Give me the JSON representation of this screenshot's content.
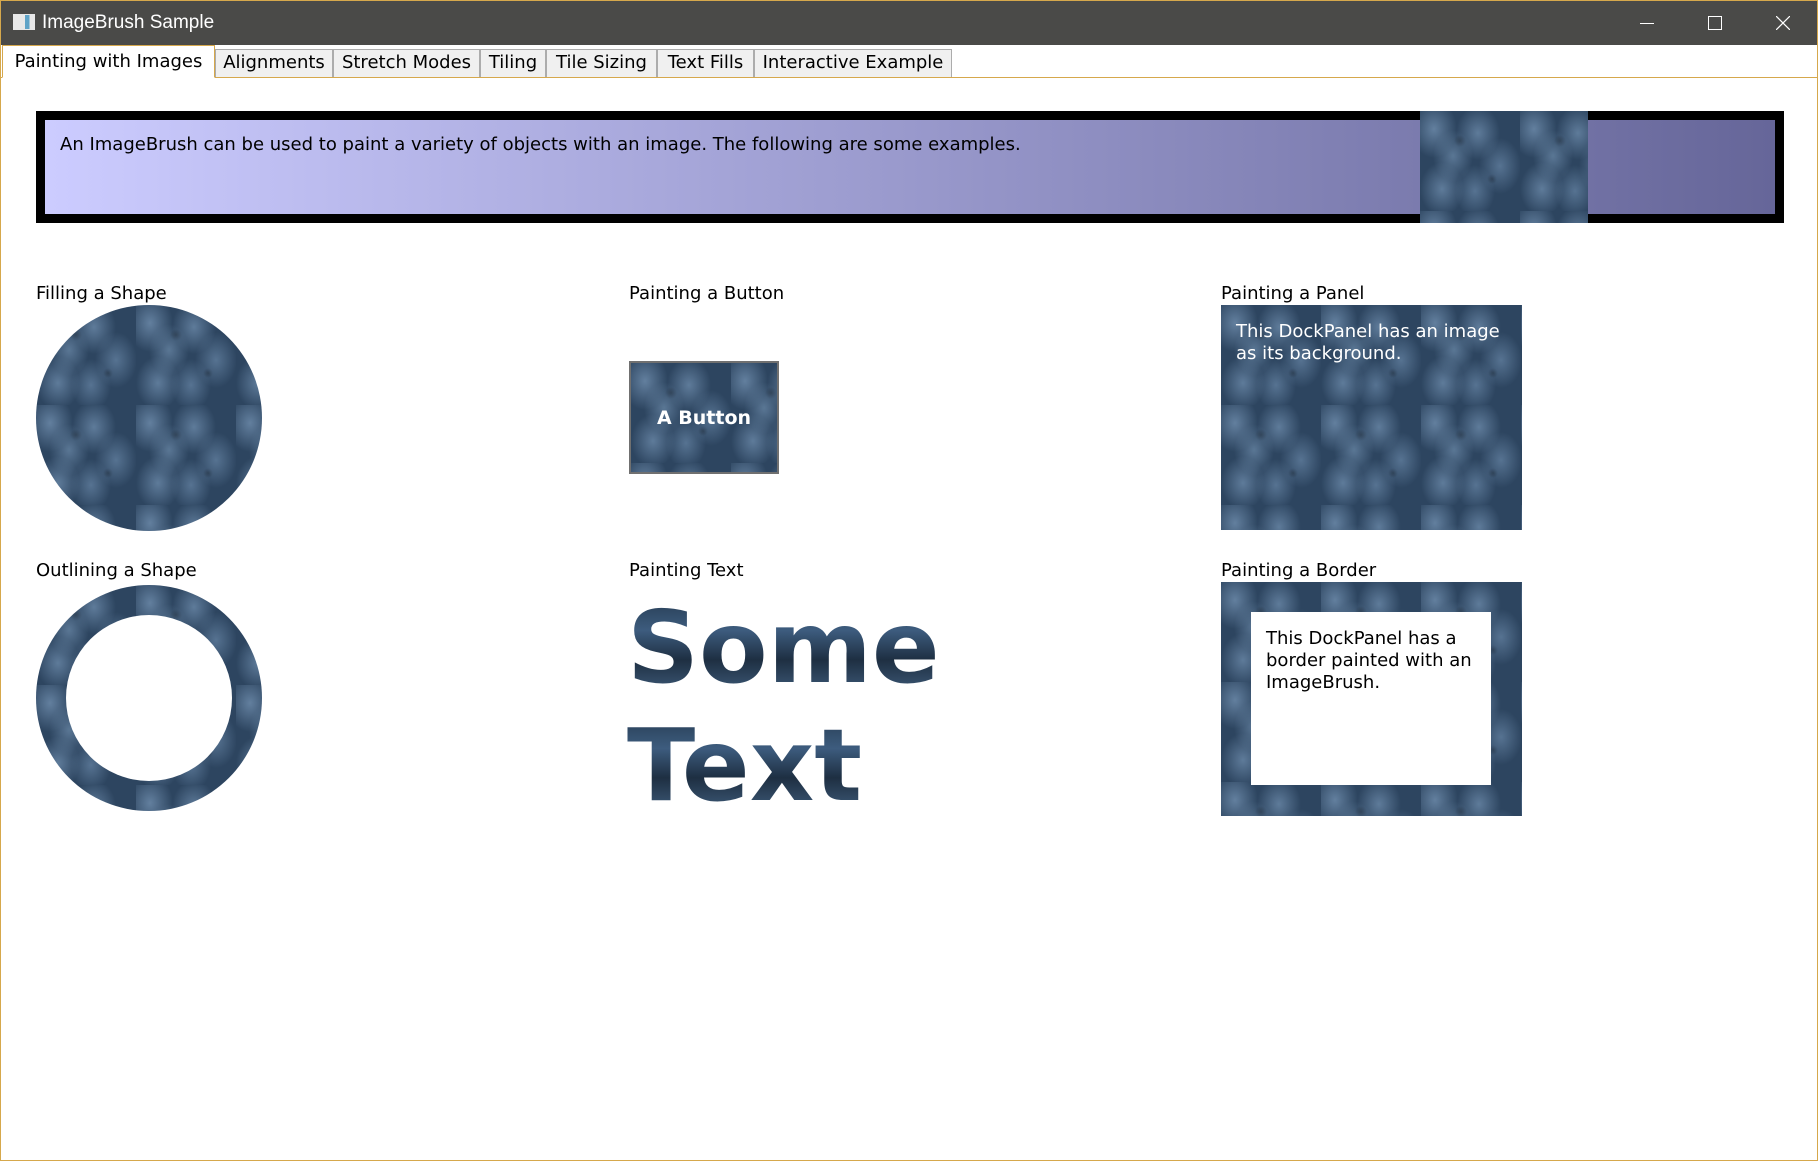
{
  "window": {
    "title": "ImageBrush Sample"
  },
  "tabs": [
    {
      "label": "Painting with Images",
      "active": true
    },
    {
      "label": "Alignments"
    },
    {
      "label": "Stretch Modes"
    },
    {
      "label": "Tiling"
    },
    {
      "label": "Tile Sizing"
    },
    {
      "label": "Text Fills"
    },
    {
      "label": "Interactive Example"
    }
  ],
  "content": {
    "intro": "An ImageBrush can be used to paint a variety of objects with an image. The following are some examples.",
    "filling_shape": {
      "label": "Filling a Shape"
    },
    "painting_button": {
      "label": "Painting a Button",
      "button_text": "A Button"
    },
    "painting_panel": {
      "label": "Painting a Panel",
      "panel_text": "This DockPanel has an image as its background."
    },
    "outlining_shape": {
      "label": "Outlining a Shape"
    },
    "painting_text": {
      "label": "Painting Text",
      "line1": "Some",
      "line2": "Text"
    },
    "painting_border": {
      "label": "Painting a Border",
      "border_text": "This DockPanel has a border painted with an ImageBrush."
    }
  },
  "colors": {
    "gradient_start": "#ccccff",
    "gradient_end": "#666699",
    "window_accent": "#d6a84c",
    "titlebar": "#4a4a48"
  },
  "icons": {
    "app": "window-icon",
    "minimize": "minimize-icon",
    "maximize": "maximize-icon",
    "close": "close-icon"
  }
}
